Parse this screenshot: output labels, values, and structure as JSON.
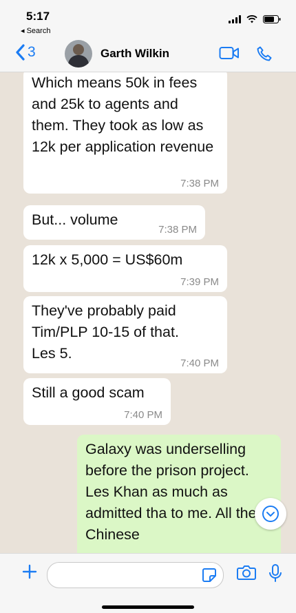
{
  "status_bar": {
    "time": "5:17",
    "back_app": "◂ Search"
  },
  "header": {
    "back_count": "3",
    "contact_name": "Garth Wilkin"
  },
  "messages": [
    {
      "direction": "in",
      "text": "Which means 50k in fees and 25k to agents and them. They took as low as 12k per application revenue",
      "time": "7:38 PM"
    },
    {
      "direction": "in",
      "text": "But... volume",
      "time": "7:38 PM"
    },
    {
      "direction": "in",
      "text": "12k x 5,000 = US$60m",
      "time": "7:39 PM"
    },
    {
      "direction": "in",
      "text": "They've probably paid Tim/PLP 10-15 of that. Les 5.",
      "time": "7:40 PM"
    },
    {
      "direction": "in",
      "text": "Still a good scam",
      "time": "7:40 PM"
    },
    {
      "direction": "out",
      "text": "Galaxy was underselling before the prison project. Les Khan as much as admitted tha to me. All the Chinese",
      "time": ""
    }
  ],
  "icons": {
    "back": "chevron-left-icon",
    "video": "video-camera-icon",
    "phone": "phone-icon",
    "scroll_down": "chevron-down-circle-icon",
    "plus": "plus-icon",
    "sticker": "sticker-icon",
    "camera": "camera-icon",
    "mic": "microphone-icon"
  },
  "colors": {
    "accent": "#1b7cf3",
    "outgoing_bubble": "#dbf7c6",
    "incoming_bubble": "#ffffff",
    "chat_background": "#e9e2d9"
  }
}
